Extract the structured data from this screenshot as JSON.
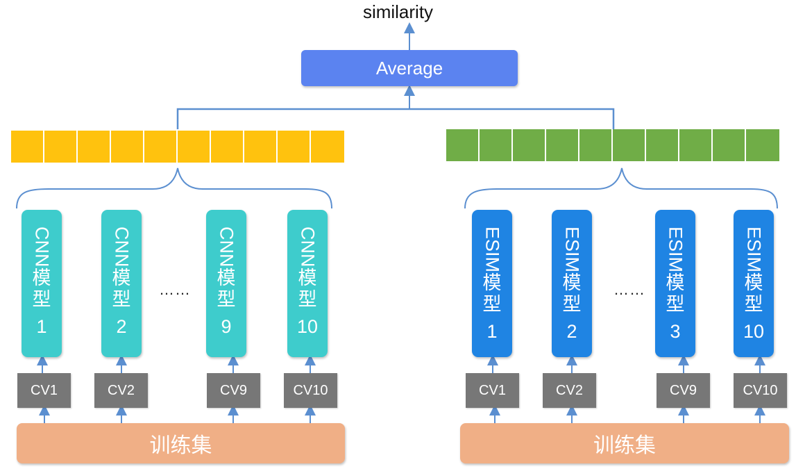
{
  "output_label": "similarity",
  "average_label": "Average",
  "colors": {
    "average": "#5B83F0",
    "cnn_vector": "#FFC20E",
    "esim_vector": "#70AD47",
    "cnn_model": "#3ECCCC",
    "esim_model": "#1F84E3",
    "cv_box": "#777777",
    "train_box": "#F0AF86",
    "connector": "#5B8FD0"
  },
  "cnn_group": {
    "vector_cells": 10,
    "ellipsis": "……",
    "models": [
      {
        "name": "CNN",
        "suffix1": "模",
        "suffix2": "型",
        "number": "1",
        "cv": "CV1"
      },
      {
        "name": "CNN",
        "suffix1": "模",
        "suffix2": "型",
        "number": "2",
        "cv": "CV2"
      },
      {
        "name": "CNN",
        "suffix1": "模",
        "suffix2": "型",
        "number": "9",
        "cv": "CV9"
      },
      {
        "name": "CNN",
        "suffix1": "模",
        "suffix2": "型",
        "number": "10",
        "cv": "CV10"
      }
    ],
    "train_label": "训练集"
  },
  "esim_group": {
    "vector_cells": 10,
    "ellipsis": "……",
    "models": [
      {
        "name": "ESIM",
        "suffix1": "模",
        "suffix2": "型",
        "number": "1",
        "cv": "CV1"
      },
      {
        "name": "ESIM",
        "suffix1": "模",
        "suffix2": "型",
        "number": "2",
        "cv": "CV2"
      },
      {
        "name": "ESIM",
        "suffix1": "模",
        "suffix2": "型",
        "number": "3",
        "cv": "CV9"
      },
      {
        "name": "ESIM",
        "suffix1": "模",
        "suffix2": "型",
        "number": "10",
        "cv": "CV10"
      }
    ],
    "train_label": "训练集"
  }
}
